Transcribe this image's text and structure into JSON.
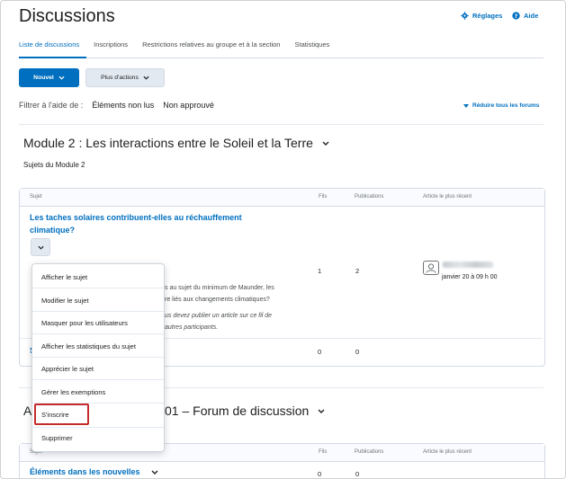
{
  "header": {
    "title": "Discussions",
    "settings_label": "Réglages",
    "help_label": "Aide"
  },
  "tabs": [
    {
      "label": "Liste de discussions"
    },
    {
      "label": "Inscriptions"
    },
    {
      "label": "Restrictions relatives au groupe et à la section"
    },
    {
      "label": "Statistiques"
    }
  ],
  "toolbar": {
    "new_label": "Nouvel",
    "more_actions_label": "Plus d'actions"
  },
  "filter": {
    "label": "Filtrer à l'aide de :",
    "option_unread": "Éléments non lus",
    "option_unapproved": "Non approuvé",
    "collapse_label": "Réduire tous les forums"
  },
  "forum1": {
    "title": "Module 2 : Les interactions entre le Soleil et la Terre",
    "subtitle": "Sujets du Module 2",
    "columns": {
      "subject": "Sujet",
      "threads": "Fils",
      "posts": "Publications",
      "recent": "Article le plus récent"
    },
    "topic1": {
      "title_line1": "Les taches solaires contribuent-elles au réchauffement",
      "title_line2": "climatique?",
      "desc_line1": "s au sujet du minimum de Maunder, les",
      "desc_line2": "re liés aux changements climatiques?",
      "note_line1": "us devez publier un article sur ce fil de",
      "note_line2": "autres participants.",
      "threads": "1",
      "posts": "2",
      "recent_date": "janvier 20 à 09 h 00"
    },
    "topic2": {
      "title_fragment": "S",
      "threads": "0",
      "posts": "0"
    }
  },
  "forum2": {
    "title_prefix": "A",
    "title_rest": "01 – Forum de discussion",
    "columns": {
      "subject": "Sujet",
      "threads": "Fils",
      "posts": "Publications",
      "recent": "Article le plus récent"
    },
    "topic1": {
      "title": "Éléments dans les nouvelles",
      "threads": "0",
      "posts": "0"
    }
  },
  "menu": {
    "items": [
      {
        "label": "Afficher le sujet"
      },
      {
        "label": "Modifier le sujet"
      },
      {
        "label": "Masquer pour les utilisateurs"
      },
      {
        "label": "Afficher les statistiques du sujet"
      },
      {
        "label": "Apprécier le sujet"
      },
      {
        "label": "Gérer les exemptions"
      },
      {
        "label": "S'inscrire"
      },
      {
        "label": "Supprimer"
      }
    ],
    "highlighted_index": 6
  },
  "colors": {
    "accent": "#006fbf",
    "highlight_border": "#c52b2b"
  }
}
